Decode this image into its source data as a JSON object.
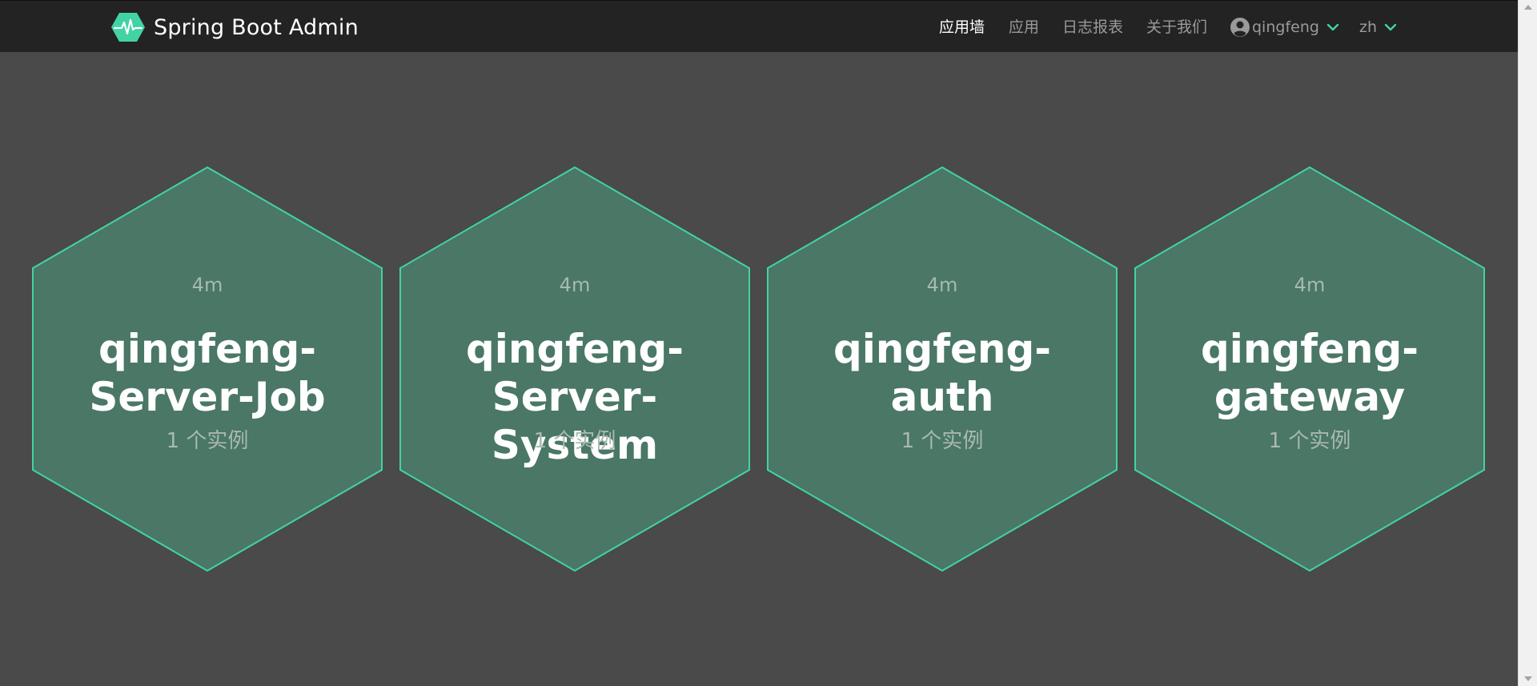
{
  "navbar": {
    "brand": "Spring Boot Admin",
    "items": [
      {
        "label": "应用墙",
        "active": true
      },
      {
        "label": "应用",
        "active": false
      },
      {
        "label": "日志报表",
        "active": false
      },
      {
        "label": "关于我们",
        "active": false
      }
    ],
    "user": {
      "name": "qingfeng",
      "icon": "user-circle-icon"
    },
    "language": {
      "value": "zh",
      "icon": "chevron-down-icon"
    }
  },
  "applications": [
    {
      "age": "4m",
      "name_line1": "qingfeng-",
      "name_line2": "Server-Job",
      "instances": "1 个实例"
    },
    {
      "age": "4m",
      "name_line1": "qingfeng-",
      "name_line2": "Server-System",
      "instances": "1 个实例"
    },
    {
      "age": "4m",
      "name_line1": "qingfeng-",
      "name_line2": "auth",
      "instances": "1 个实例"
    },
    {
      "age": "4m",
      "name_line1": "qingfeng-",
      "name_line2": "gateway",
      "instances": "1 个实例"
    }
  ],
  "colors": {
    "background": "#4a4a4a",
    "navbar": "#232323",
    "hex_fill": "#4a7766",
    "hex_stroke": "#42d3a5",
    "accent": "#42d3a5"
  }
}
